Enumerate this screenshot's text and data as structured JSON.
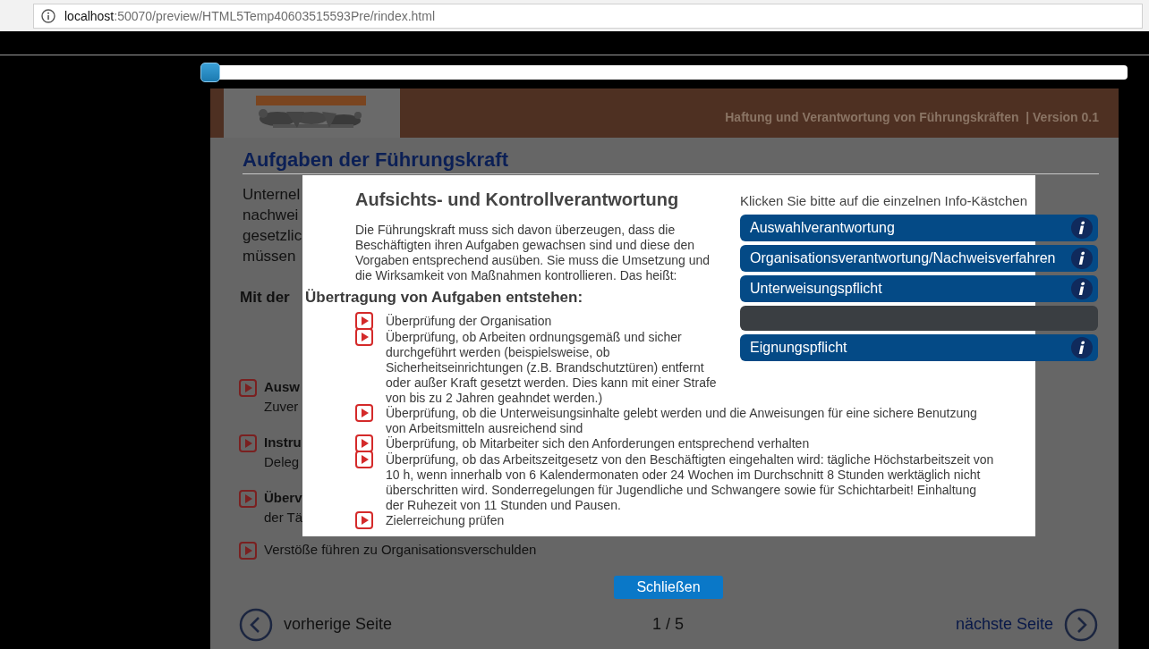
{
  "browser": {
    "url_host": "localhost",
    "url_path": ":50070/preview/HTML5Temp40603515593Pre/rindex.html"
  },
  "progress_slider": {
    "level": 0
  },
  "header": {
    "title": "Haftung und Verantwortung von Führungskräften",
    "version": "| Version 0.1"
  },
  "page": {
    "heading": "Aufgaben der Führungskraft",
    "intro_lines": [
      "Unternel",
      "nachwei",
      "gesetzlic",
      "müssen"
    ],
    "subheading_start": "Mit der",
    "subheading": "Übertragung von Aufgaben entstehen:",
    "instruction": "Klicken Sie bitte auf die einzelnen Info-Kästchen",
    "items": [
      {
        "title": "Ausw",
        "text": "Zuver"
      },
      {
        "title": "Instru",
        "text": "Deleg"
      },
      {
        "title": "Überv",
        "text": "der Tä"
      },
      {
        "text": "Verstöße führen zu Organisationsverschulden"
      }
    ]
  },
  "modal": {
    "title": "Aufsichts- und Kontrollverantwortung",
    "intro": "Die Führungskraft muss sich davon überzeugen, dass die Beschäftigten ihren Aufgaben gewachsen sind und diese den Vorgaben entsprechend ausüben. Sie muss die Umsetzung und die Wirksamkeit von Maßnahmen kontrollieren. Das heißt:",
    "bullets": [
      "Überprüfung der Organisation",
      "Überprüfung, ob Arbeiten ordnungsgemäß und sicher durchgeführt werden (beispielsweise, ob Sicherheitseinrichtungen (z.B. Brandschutztüren) entfernt oder außer Kraft gesetzt werden. Dies kann mit einer Strafe von bis zu 2 Jahren geahndet werden.)",
      "Überprüfung, ob die Unterweisungsinhalte gelebt werden und die Anweisungen für eine sichere Benutzung von Arbeitsmitteln ausreichend sind",
      "Überprüfung, ob Mitarbeiter sich den Anforderungen entsprechend verhalten",
      "Überprüfung, ob das Arbeitszeitgesetz von den Beschäftigten eingehalten wird: tägliche Höchstarbeitszeit von 10 h, wenn innerhalb von 6 Kalendermonaten oder 24 Wochen im Durchschnitt 8 Stunden werktäglich nicht überschritten wird. Sonderregelungen für Jugendliche und Schwangere sowie für Schichtarbeit! Einhaltung der Ruhezeit von 11 Stunden und Pausen.",
      "Zielerreichung prüfen"
    ],
    "close_button": "Schließen"
  },
  "info_buttons": [
    {
      "kind": "button",
      "label": "Auswahlverantwortung"
    },
    {
      "kind": "button",
      "label": "Organisationsverantwortung/Nachweisverfahren"
    },
    {
      "kind": "button",
      "label": "Unterweisungspflicht"
    },
    {
      "kind": "empty"
    },
    {
      "kind": "button",
      "label": "Eignungspflicht"
    }
  ],
  "pager": {
    "previous": "vorherige Seite",
    "position": "1 / 5",
    "next": "nächste Seite"
  }
}
